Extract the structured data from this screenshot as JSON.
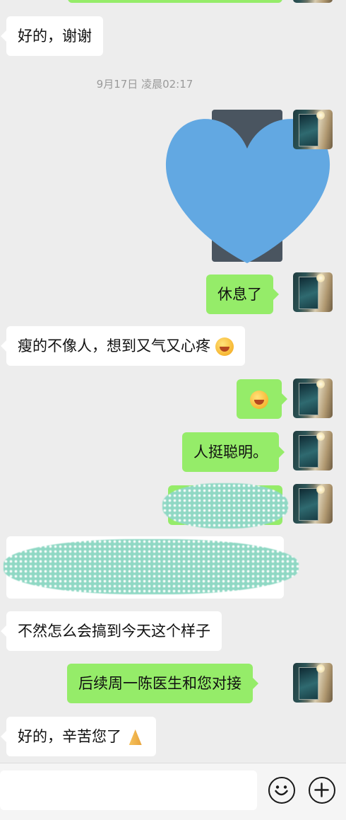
{
  "messages": [
    {
      "id": "m1",
      "side": "in",
      "text": "好的，谢谢"
    },
    {
      "id": "m2",
      "side": "out",
      "type": "image-redacted"
    },
    {
      "id": "m3",
      "side": "out",
      "text": "休息了"
    },
    {
      "id": "m4",
      "side": "in",
      "text": "瘦的不像人，想到又气又心疼",
      "emoji": "laugh-emoji"
    },
    {
      "id": "m5",
      "side": "out",
      "type": "emoji-only",
      "emoji": "laugh-emoji"
    },
    {
      "id": "m6",
      "side": "out",
      "text": "人挺聪明。"
    },
    {
      "id": "m7",
      "side": "out",
      "type": "redacted"
    },
    {
      "id": "m8",
      "side": "in",
      "type": "redacted"
    },
    {
      "id": "m9",
      "side": "in",
      "text": "不然怎么会搞到今天这个样子"
    },
    {
      "id": "m10",
      "side": "out",
      "text": "后续周一陈医生和您对接"
    },
    {
      "id": "m11",
      "side": "in",
      "text": "好的，辛苦您了",
      "emoji": "pray-emoji"
    }
  ],
  "timestamp": "9月17日 凌晨02:17",
  "colors": {
    "background": "#ededed",
    "outgoing_bubble": "#95ec69",
    "incoming_bubble": "#ffffff",
    "redaction_heart": "#62a8e2",
    "redaction_dots": "#8fd8c4"
  },
  "input_bar": {
    "emoji_button_icon": "smiley-icon",
    "more_button_icon": "plus-circle-icon"
  }
}
